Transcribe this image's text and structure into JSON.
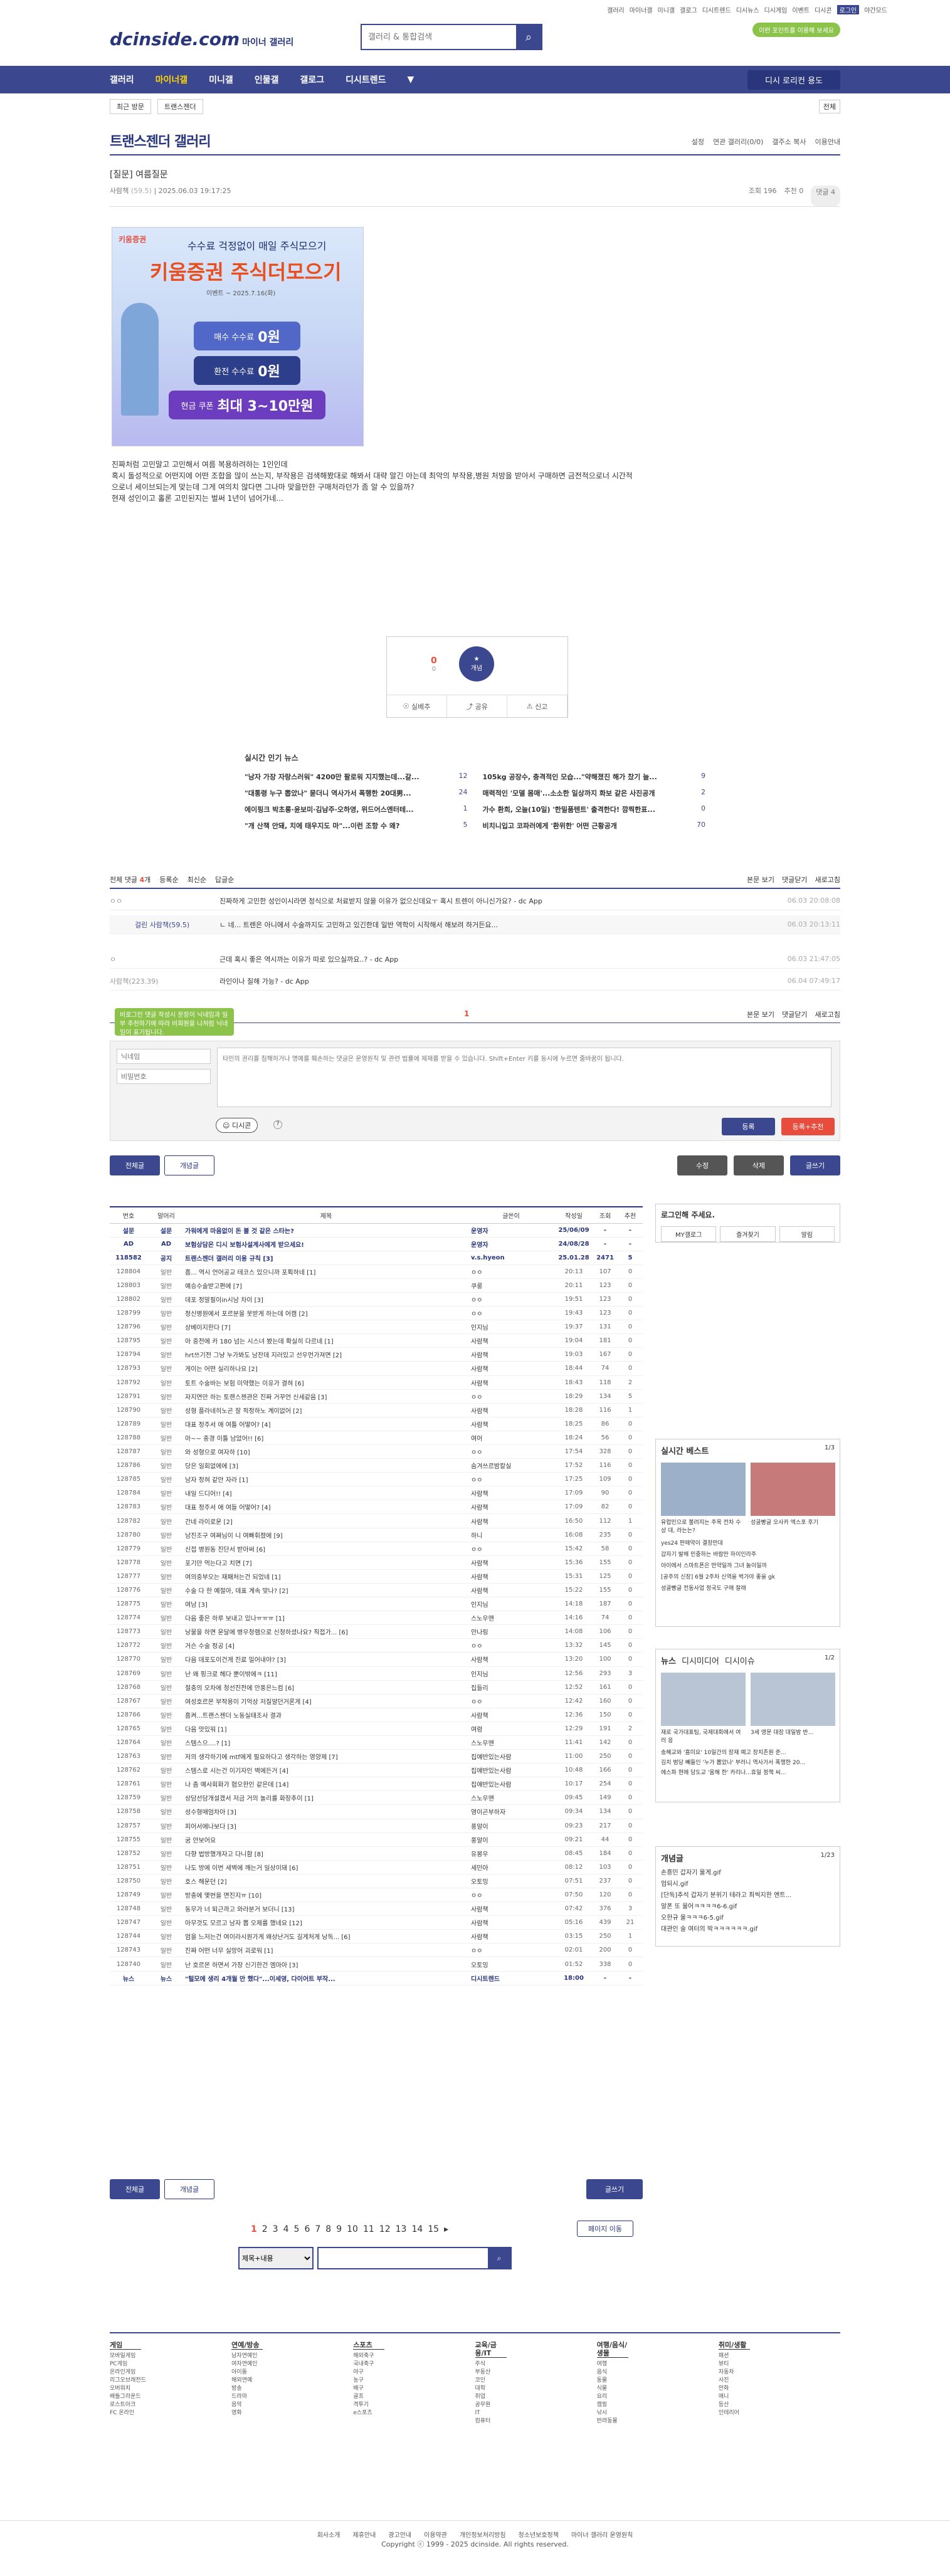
{
  "topnav": [
    "갤러리",
    "마이너갤",
    "미니갤",
    "갤로그",
    "디시트렌드",
    "디시뉴스",
    "디시게임",
    "이벤트",
    "디시콘",
    "로그인",
    "야간모드"
  ],
  "header": {
    "logo": "dcinside.com",
    "logo_sub": "마이너 갤러리",
    "search_placeholder": "갤러리 & 통합검색",
    "pill": "이런 포인트를 이용해 보세요"
  },
  "gnb": {
    "items": [
      "갤러리",
      "마이너갤",
      "미니갤",
      "인물갤",
      "갤로그",
      "디시트렌드"
    ],
    "active": "마이너갤",
    "right": "디시 로리컨 용도"
  },
  "sub": {
    "chip1": "최근 방문",
    "chip2": "트랜스젠더",
    "right": "전체"
  },
  "gallery": {
    "title": "트랜스젠더 갤러리",
    "right": [
      "설정",
      "연관 갤러리(0/0)",
      "갤주소 복사",
      "이용안내"
    ]
  },
  "post": {
    "title": "[질문] 여름질문",
    "writer": "사람책",
    "ip": "(59.5)",
    "date": "2025.06.03 19:17:25",
    "views": "조회 196",
    "recommend": "추천 0",
    "comments": "댓글 4",
    "body": [
      "진짜처럼 고민말고 고민해서 여름 복용하려하는 1인인데",
      "혹시 돌성적으로 어떤지에 어떤 조합을 많이 쓰는지, 부작용은 검색해봤대로 해봐서 대략 알긴 아는데 최악의 부작용,병원 처방을 받아서 구매하면 금전적으로너 시간적",
      "으로너 세이브되는게 맞는데 그게 여의치 않다면 그나마 맞을만한 구매처라던가 좀 알 수 있을까?",
      "현재 성인이고 홀론 고민된지는 벌써 1년이 넘어가네..."
    ]
  },
  "ad": {
    "brand": "키움증권",
    "t1": "수수료 걱정없이 매일 주식모으기",
    "t2": "키움증권 주식더모으기",
    "t3": "이벤트 ~ 2025.7.16(화)",
    "b1a": "매수 수수료",
    "b1b": "0원",
    "b2a": "환전 수수료",
    "b2b": "0원",
    "b3a": "현금 쿠폰",
    "b3b": "최대 3~10만원"
  },
  "vote": {
    "up": "0",
    "up_sub": "0",
    "circle": "개념",
    "btn1": "실베추",
    "btn2": "공유",
    "btn3": "신고"
  },
  "news": {
    "title": "실시간 인기 뉴스",
    "items": [
      {
        "t": "\"남자 가장 자랑스러워\" 4200만 팔로워 지지했는데...갈...",
        "n": "12"
      },
      {
        "t": "105kg 공장수, 충격적인 모습...\"약해졌진 해가 찼기 늘...",
        "n": "9"
      },
      {
        "t": "\"대통령 누구 뽑았나\" 묻더니 역사가서 폭행한 20대男...",
        "n": "24"
      },
      {
        "t": "매력적인 '모델 몸매'...소소한 일상까지 화보 같은 사진공개",
        "n": "2"
      },
      {
        "t": "에이핑크 박초롱·윤보미·김남주·오하영, 위드어스엔터테...",
        "n": "1"
      },
      {
        "t": "가수 환희, 오늘(10일) '한밀품텐트' 출격한다! 깜찍한표...",
        "n": "0"
      },
      {
        "t": "\"개 산책 안돼, 치에 태우지도 마\"...이런 조항 수 왜?",
        "n": "5"
      },
      {
        "t": "비치니입고 코파러에게 '환위한' 어떤 근황공개",
        "n": "70"
      }
    ]
  },
  "comments": {
    "label_total": "전체 댓글",
    "total": "4",
    "label_unit": "개",
    "opts": [
      "등록순",
      "최신순",
      "답글순"
    ],
    "right": [
      "본문 보기",
      "댓글닫기",
      "새로고침"
    ],
    "rows": [
      {
        "w": "ㅇㅇ",
        "c": "진짜하게 고민한 성인이시라면 정식으로 처료받지 않을 이유가 없으신데요ㅜ 혹시 트렌이 아니신가요? - dc App",
        "d": "06.03 20:08:08"
      },
      {
        "w": "걸린 사람책(59.5)",
        "c": "ㄴ 네... 트렌은 아니에서 수술까지도 고민하고 있긴한데 일반 역학이 시작해서 해보려 하거든요...",
        "d": "06.03 20:13:11"
      },
      {
        "w": "ㅇ",
        "c": "근데 혹시 좋은 역시까는 이유가 따로 있으실까요..? - dc App",
        "d": "06.03 21:47:05"
      },
      {
        "w": "사람책(223.39)",
        "c": "라인이나 질해 가능? - dc App",
        "d": "06.04 07:49:17"
      }
    ],
    "page": "1"
  },
  "write": {
    "tip": "비로그인 댓글 작성시 문장이 닉네임과 일부 추천하기에 따라 비회원을 나처럼 닉네임이 표기됩니다.",
    "name_ph": "닉네임",
    "pw_ph": "비밀번호",
    "text_ph": "타인의 권리를 침해하거나 명예를 훼손하는 댓글은 운영원칙 및 관련 법률에 제재를 받을 수 있습니다. Shift+Enter 키를 동시에 누르면 줄바꿈이 됩니다.",
    "dccon": "디시콘",
    "submit": "등록",
    "submit2": "등록+추천"
  },
  "buttons": {
    "all": "전체글",
    "concept": "개념글",
    "edit": "수정",
    "delete": "삭제",
    "write": "글쓰기",
    "write2": "글쓰기",
    "page_move": "페이지 이동"
  },
  "list": {
    "headers": [
      "번호",
      "말머리",
      "제목",
      "글쓴이",
      "작성일",
      "조회",
      "추천"
    ],
    "rows": [
      [
        "설문",
        "설문",
        "가워에게 마음없이 돈 볼 것 같은 스타는?",
        "운영자",
        "25/06/09",
        "-",
        "-"
      ],
      [
        "AD",
        "AD",
        "보험상담은 디시 보험사설계사에게 받으세요!",
        "운영자",
        "24/08/28",
        "-",
        "-"
      ],
      [
        "118582",
        "공지",
        "트랜스젠더 갤러리 이용 규칙 [3]",
        "v.s.hyeon",
        "25.01.28",
        "2471",
        "5"
      ],
      [
        "128804",
        "일반",
        "흠... 역시 언어공교 테코스 있으니까 포획하네 [1]",
        "ㅇㅇ",
        "20:13",
        "107",
        "0"
      ],
      [
        "128803",
        "일반",
        "예승수술받고편에 [7]",
        "쿠룽",
        "20:11",
        "123",
        "0"
      ],
      [
        "128802",
        "일반",
        "데포 정말필이in시남 차이 [3]",
        "ㅇㅇ",
        "19:51",
        "123",
        "0"
      ],
      [
        "128799",
        "일반",
        "정신병원에서 포르분을 못받게 하는데 어캠 [2]",
        "ㅇㅇ",
        "19:43",
        "123",
        "0"
      ],
      [
        "128796",
        "일반",
        "상베이지한다 [7]",
        "인지님",
        "19:37",
        "131",
        "0"
      ],
      [
        "128795",
        "일반",
        "아 중전에 카 180 넘는 시스녀 봤는데 확실히 다르네 [1]",
        "사람책",
        "19:04",
        "181",
        "0"
      ],
      [
        "128794",
        "일반",
        "hrt쓰기전 그냥 누가봐도 남잔데 지러있고 선우먼가져면 [2]",
        "사람책",
        "19:03",
        "167",
        "0"
      ],
      [
        "128793",
        "일반",
        "게이는 어떤 실리하나요 [2]",
        "사람책",
        "18:44",
        "74",
        "0"
      ],
      [
        "128792",
        "일반",
        "토트 수술바는 보험 미약했는 이유가 결혀 [6]",
        "사람책",
        "18:43",
        "118",
        "2"
      ],
      [
        "128791",
        "일반",
        "자지연만 하는 토랜스젠관은 진짜 거꾸언 신세같음 [3]",
        "ㅇㅇ",
        "18:29",
        "134",
        "5"
      ],
      [
        "128790",
        "일반",
        "성형 플라네히노곤 잘 적정하노 계이없어 [2]",
        "사람책",
        "18:28",
        "116",
        "1"
      ],
      [
        "128789",
        "일반",
        "대표 정주서 애 여틀 어떻어? [4]",
        "사람책",
        "18:25",
        "86",
        "0"
      ],
      [
        "128788",
        "일반",
        "아~~ 충경 이틀 남았어!! [6]",
        "여어",
        "18:24",
        "56",
        "0"
      ],
      [
        "128787",
        "일반",
        "와 성형으로 여자하 [10]",
        "ㅇㅇ",
        "17:54",
        "328",
        "0"
      ],
      [
        "128786",
        "일반",
        "당은 일회없에에 [3]",
        "숨겨쓰르밤칼실",
        "17:52",
        "116",
        "0"
      ],
      [
        "128785",
        "일반",
        "남자 정혀 같안 자라 [1]",
        "ㅇㅇ",
        "17:25",
        "109",
        "0"
      ],
      [
        "128784",
        "일반",
        "내일 드디어!! [4]",
        "사람책",
        "17:09",
        "90",
        "0"
      ],
      [
        "128783",
        "일반",
        "대표 정주서 애 여들 어떻어? [4]",
        "사람책",
        "17:09",
        "82",
        "0"
      ],
      [
        "128782",
        "일반",
        "간네 라이로운 [2]",
        "사람책",
        "16:50",
        "112",
        "1"
      ],
      [
        "128780",
        "일반",
        "남진조구 여쪄님이 니 여빠휘졌에 [9]",
        "하니",
        "16:08",
        "235",
        "0"
      ],
      [
        "128779",
        "일반",
        "신접 병원동 진단서 받아써 [6]",
        "ㅇㅇ",
        "15:42",
        "58",
        "0"
      ],
      [
        "128778",
        "일반",
        "포기만 먹는다고 치면 [7]",
        "사람책",
        "15:36",
        "155",
        "0"
      ],
      [
        "128777",
        "일반",
        "여의중부오는 재패처는건 되었네 [1]",
        "사람책",
        "15:31",
        "125",
        "0"
      ],
      [
        "128776",
        "일반",
        "수술 다 한 예절아, 데표 계속 맞나? [2]",
        "사람책",
        "15:22",
        "155",
        "0"
      ],
      [
        "128775",
        "일반",
        "여남 [3]",
        "인지님",
        "14:18",
        "187",
        "0"
      ],
      [
        "128774",
        "일반",
        "다음 좋은 하루 보내고 있나ㅠㅠㅠ [1]",
        "스노우맨",
        "14:16",
        "74",
        "0"
      ],
      [
        "128773",
        "일반",
        "낭물을 하면 운달에 병우청램으로 신청하셨나요? 직접가... [6]",
        "안나링",
        "14:08",
        "106",
        "0"
      ],
      [
        "128772",
        "일반",
        "거슨 수술 정공 [4]",
        "ㅇㅇ",
        "13:32",
        "145",
        "0"
      ],
      [
        "128770",
        "일반",
        "다음 데포도이건게 진료 밀어내야? [3]",
        "사람책",
        "13:20",
        "100",
        "0"
      ],
      [
        "128769",
        "일반",
        "난 왜 핑크로 헤다 뿐이밖에ㅋ [11]",
        "인지님",
        "12:56",
        "293",
        "3"
      ],
      [
        "128768",
        "일반",
        "절충의 오차에 청선진전에 안풍은느컴 [6]",
        "집들리",
        "12:52",
        "161",
        "0"
      ],
      [
        "128767",
        "일반",
        "여성호르몬 부작용이 기억상 저질알던거론게 [4]",
        "ㅇㅇ",
        "12:42",
        "160",
        "0"
      ],
      [
        "128766",
        "일반",
        "흠켜...트랜스젠더 노동실태조사 결과",
        "사람책",
        "12:36",
        "150",
        "0"
      ],
      [
        "128765",
        "일반",
        "다음 맛있워 [1]",
        "여령",
        "12:29",
        "191",
        "2"
      ],
      [
        "128764",
        "일반",
        "스템스으....? [1]",
        "스노우맨",
        "11:41",
        "142",
        "0"
      ],
      [
        "128763",
        "일반",
        "저의 생각하기에 mtf에게 필요하다고 생각하는 영양제 [7]",
        "집얘반있는사람",
        "11:00",
        "250",
        "0"
      ],
      [
        "128762",
        "일반",
        "스템스로 시는건 이기자인 벽에든거 [4]",
        "집얘반있는사람",
        "10:48",
        "166",
        "0"
      ],
      [
        "128761",
        "일반",
        "나 좀 예사회화가 협오한인 같은데 [14]",
        "집얘반있는사람",
        "10:17",
        "254",
        "0"
      ],
      [
        "128759",
        "일반",
        "상담선담개설겠서 저금 거의 놀리를 화장추이 [1]",
        "스노우맨",
        "09:45",
        "149",
        "0"
      ],
      [
        "128758",
        "일반",
        "성수형매엄차아 [3]",
        "영이곤부하자",
        "09:34",
        "134",
        "0"
      ],
      [
        "128757",
        "일반",
        "피어서에나보다 [3]",
        "풍알이",
        "09:23",
        "217",
        "0"
      ],
      [
        "128755",
        "일반",
        "굼 안보어요",
        "풍알이",
        "09:21",
        "44",
        "0"
      ],
      [
        "128752",
        "일반",
        "다향 법방했개자고 다니함 [8]",
        "유봉우",
        "08:45",
        "184",
        "0"
      ],
      [
        "128751",
        "일반",
        "나도 방에 이번 세벽에 깨는거 일상이돼 [6]",
        "세민아",
        "08:12",
        "103",
        "0"
      ],
      [
        "128750",
        "일반",
        "호스 해운던 [2]",
        "오토밍",
        "07:51",
        "237",
        "0"
      ],
      [
        "128749",
        "일반",
        "방충에 몇번을 면진지ㅠ [10]",
        "ㅇㅇ",
        "07:50",
        "120",
        "0"
      ],
      [
        "128748",
        "일반",
        "동무가 너 퇴근까고 와라분거 보더니 [13]",
        "사람책",
        "07:42",
        "376",
        "3"
      ],
      [
        "128747",
        "일반",
        "아무것도 모르고 남자 뽑 오제를 했네요 [12]",
        "사람책",
        "05:16",
        "439",
        "21"
      ],
      [
        "128744",
        "일반",
        "엄을 느저는건 여이라시원가게 왜상난거도 길게처게 낭독... [6]",
        "사람책",
        "03:15",
        "250",
        "1"
      ],
      [
        "128743",
        "일반",
        "진짜 어떤 너무 실망어 괴로워 [1]",
        "ㅇㅇ",
        "02:01",
        "200",
        "0"
      ],
      [
        "128740",
        "일반",
        "난 호르몬 하면서 가장 신기한건 엠마아 [3]",
        "오토밍",
        "01:52",
        "338",
        "0"
      ],
      [
        "뉴스",
        "뉴스",
        "\"털모에 생리 4개월 안 했다\"...이세영, 다이어트 부작...",
        "디시트렌드",
        "18:00",
        "-",
        "-"
      ]
    ]
  },
  "side": {
    "login": "로그인해 주세요.",
    "login_btn": "MY갤로그",
    "login_btn2": "즐겨찾기",
    "login_btn3": "알림",
    "hot_title": "실시간 베스트",
    "hot_page": "1/3",
    "hot_caps": [
      "유럽민으로 불려지는 주목 전차 수상 대, 라는는?",
      "성골빵글 오사카 엑스포 후기"
    ],
    "hot_lines": [
      "yes24 판매약이 결장만대",
      "갑자기 발해 민중하는 바람만 하이인라주",
      "아이에서 스마트폰은 만약일까 그녀 놀이일까",
      "[공주의 신장] 6월 2주차 신역을 벅가야 좋을 gk",
      "성골빵글 전동사업 정국도 구매 잘래"
    ],
    "news_tabs": [
      "뉴스",
      "디시미디어",
      "디시이슈"
    ],
    "news_page": "1/2",
    "news_caps": [
      "재로 국가대표팀, 국제대회에서 여러 응",
      "3세 영문 대장 대일밤 반..."
    ],
    "news_lines": [
      "송혜교와 '흠미요' 10일간의 장재 예고 장치존원 준...",
      "김치 범당 빼들인 '누가 뽑았나' 부러니 역사가서 폭행한 20...",
      "에스파 현에 당도교 '움해 한' 카리나...휴일 정책 씨..."
    ],
    "concept_title": "개념글",
    "concept_page": "1/23",
    "concept": [
      "손흥민 갑자기 울게.gif",
      "엄되시.gif",
      "[단독]추석 갑자기 분위기 테라고 최씩지한 엔트...",
      "알폰 또 울어ㅋㅋㅋㅋ6-6.gif",
      "오한규 울ㅋㅋㅋ6-5.gif",
      "대관인 술 여터의 박ㅋㅋㅋㅋㅋㅋ.gif"
    ]
  },
  "pagination": {
    "pages": [
      "1",
      "2",
      "3",
      "4",
      "5",
      "6",
      "7",
      "8",
      "9",
      "10",
      "11",
      "12",
      "13",
      "14",
      "15"
    ],
    "current": "1"
  },
  "bsearch": {
    "select": "제목+내용"
  },
  "footer": {
    "cats": [
      {
        "h": "게임",
        "items": [
          "모바일게임",
          "PC게임",
          "온라인게임",
          "리그오브레전드",
          "오버워치",
          "배틀그라운드",
          "로스트아크",
          "FC 온라인"
        ]
      },
      {
        "h": "연예/방송",
        "items": [
          "남자연예인",
          "여자연예인",
          "아이돌",
          "해외연예",
          "방송",
          "드라마",
          "음악",
          "영화"
        ]
      },
      {
        "h": "스포츠",
        "items": [
          "해외축구",
          "국내축구",
          "야구",
          "농구",
          "배구",
          "골프",
          "격투기",
          "e스포츠"
        ]
      },
      {
        "h": "교육/금융/IT",
        "items": [
          "주식",
          "부동산",
          "코인",
          "대학",
          "취업",
          "공무원",
          "IT",
          "컴퓨터"
        ]
      },
      {
        "h": "여행/음식/생물",
        "items": [
          "여행",
          "음식",
          "동물",
          "식물",
          "요리",
          "캠핑",
          "낚시",
          "반려동물"
        ]
      },
      {
        "h": "취미/생활",
        "items": [
          "패션",
          "뷰티",
          "자동차",
          "사진",
          "만화",
          "애니",
          "등산",
          "인테리어"
        ]
      }
    ],
    "links": [
      "회사소개",
      "제휴안내",
      "광고안내",
      "이용약관",
      "개인정보처리방침",
      "청소년보호정책",
      "마이너 갤러리 운영원칙"
    ],
    "copyright": "Copyright ⓒ 1999 - 2025 dcinside. All rights reserved."
  },
  "colors": {
    "brand": "#3b4890",
    "dark": "#29367c",
    "accent": "#e74c3c",
    "green": "#8cc34a"
  }
}
